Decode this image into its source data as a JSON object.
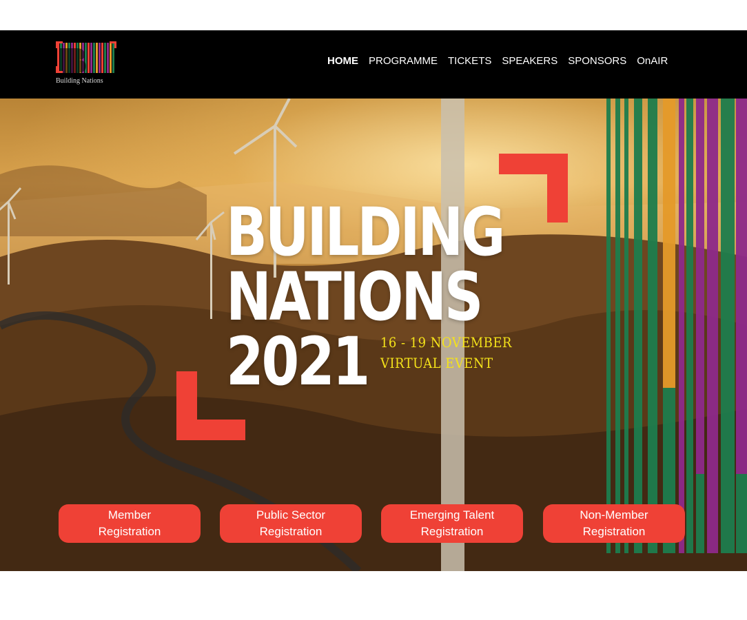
{
  "logo": {
    "text": "Building Nations",
    "icon": "building-nations-logo-icon"
  },
  "nav": [
    {
      "label": "HOME",
      "active": true
    },
    {
      "label": "PROGRAMME"
    },
    {
      "label": "TICKETS"
    },
    {
      "label": "SPEAKERS"
    },
    {
      "label": "SPONSORS"
    },
    {
      "label": "OnAIR"
    }
  ],
  "hero": {
    "title_line1": "BUILDING",
    "title_line2": "NATIONS",
    "title_line3": "2021",
    "date_line": "16 - 19 NOVEMBER",
    "event_type": "VIRTUAL EVENT"
  },
  "buttons": [
    {
      "line1": "Member",
      "line2": "Registration"
    },
    {
      "line1": "Public Sector",
      "line2": "Registration"
    },
    {
      "line1": "Emerging Talent",
      "line2": "Registration"
    },
    {
      "line1": "Non-Member",
      "line2": "Registration"
    }
  ],
  "colors": {
    "accent": "#ef4136",
    "date_yellow": "#f4e21a",
    "topbar": "#000000"
  }
}
